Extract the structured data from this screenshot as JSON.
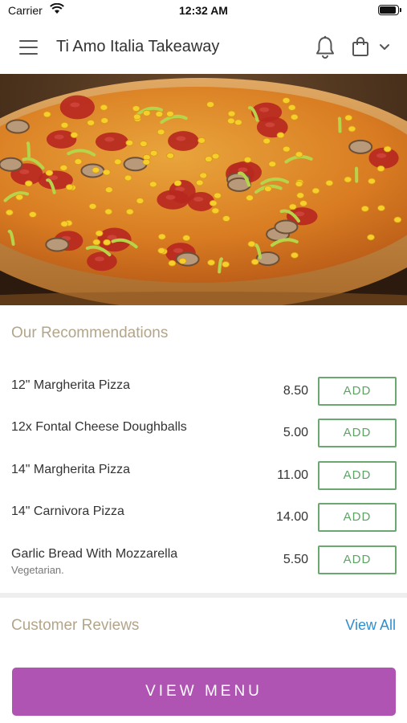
{
  "status_bar": {
    "carrier": "Carrier",
    "time": "12:32 AM",
    "battery_level": 0.95
  },
  "header": {
    "title": "Ti Amo Italia Takeaway",
    "icons": [
      "menu-icon",
      "bell-icon",
      "shopping-bag-icon",
      "chevron-down-icon"
    ]
  },
  "hero": {
    "image": "pizza-photo"
  },
  "recommendations": {
    "title": "Our Recommendations",
    "add_label": "ADD",
    "items": [
      {
        "name": "12\" Margherita Pizza",
        "price": "8.50",
        "note": ""
      },
      {
        "name": "12x Fontal Cheese Doughballs",
        "price": "5.00",
        "note": ""
      },
      {
        "name": "14\" Margherita Pizza",
        "price": "11.00",
        "note": ""
      },
      {
        "name": "14\" Carnivora Pizza",
        "price": "14.00",
        "note": ""
      },
      {
        "name": "Garlic Bread With Mozzarella",
        "price": "5.50",
        "note": "Vegetarian."
      }
    ]
  },
  "reviews": {
    "title": "Customer Reviews",
    "view_all": "View All"
  },
  "footer": {
    "view_menu": "VIEW MENU"
  },
  "colors": {
    "accent_purple": "#b054b3",
    "add_green": "#5fa266",
    "section_title": "#b3a58a",
    "link_blue": "#2d8fd1"
  }
}
